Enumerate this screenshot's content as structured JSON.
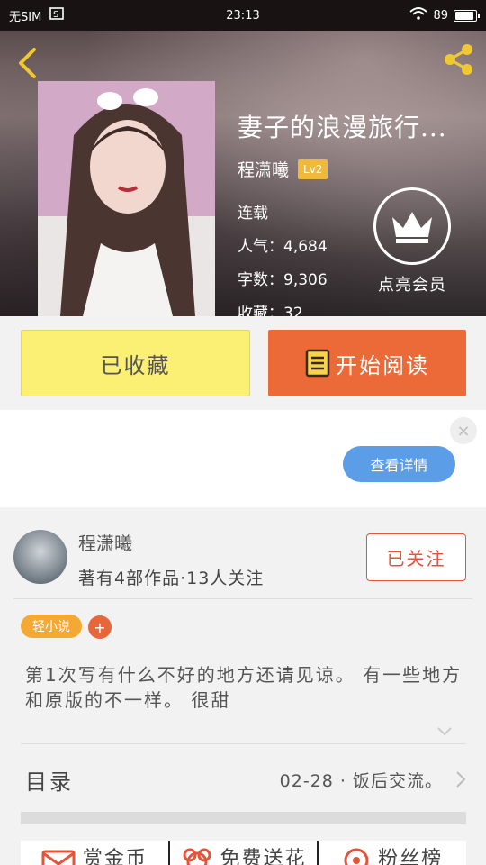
{
  "status_bar": {
    "carrier": "无SIM",
    "time": "23:13",
    "battery": "89"
  },
  "book": {
    "title": "妻子的浪漫旅行...",
    "author": "程潇曦",
    "level": "Lv2",
    "status": "连载",
    "popularity_label": "人气：",
    "popularity": "4,684",
    "words_label": "字数：",
    "words": "9,306",
    "favorites_label": "收藏：",
    "favorites": "32"
  },
  "vip": {
    "label": "点亮会员"
  },
  "actions": {
    "collect_label": "已收藏",
    "read_label": "开始阅读"
  },
  "ad": {
    "close": "×",
    "details_label": "查看详情"
  },
  "author_card": {
    "name": "程潇曦",
    "stats": "著有4部作品·13人关注",
    "follow_label": "已关注"
  },
  "tags": {
    "tag": "轻小说",
    "add": "+"
  },
  "description": "第1次写有什么不好的地方还请见谅。  有一些地方和原版的不一样。 很甜",
  "catalog": {
    "label": "目录",
    "latest": "02-28 · 饭后交流。"
  },
  "bottom_bar": {
    "items": [
      {
        "label": "赏金币"
      },
      {
        "label": "免费送花"
      },
      {
        "label": "粉丝榜"
      }
    ]
  },
  "colors": {
    "collect": "#fbef74",
    "read": "#ec6a37",
    "details": "#5b9de6",
    "badge": "#f0b93c",
    "follow": "#e2553a"
  }
}
